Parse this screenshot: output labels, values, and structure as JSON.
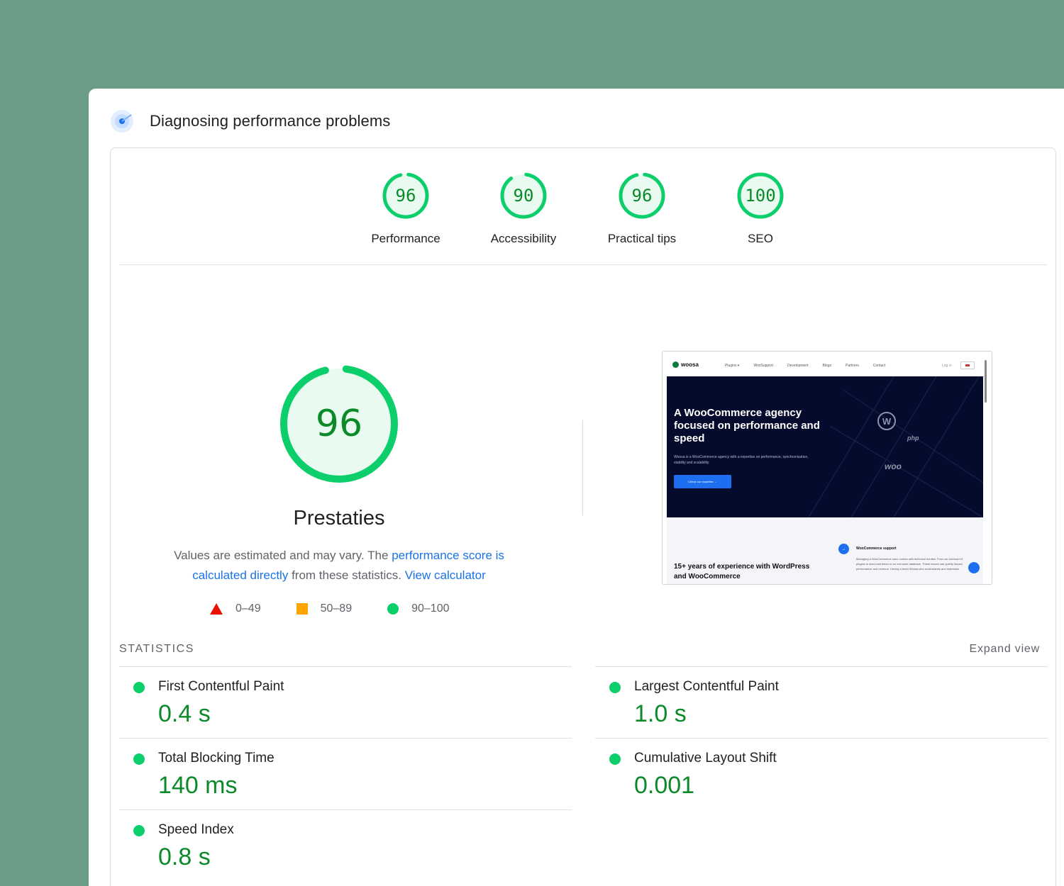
{
  "window": {
    "title": "Diagnosing performance problems"
  },
  "gauges": [
    {
      "score": "96",
      "value": 96,
      "label": "Performance"
    },
    {
      "score": "90",
      "value": 90,
      "label": "Accessibility"
    },
    {
      "score": "96",
      "value": 96,
      "label": "Practical tips"
    },
    {
      "score": "100",
      "value": 100,
      "label": "SEO"
    }
  ],
  "main_score": {
    "score": "96",
    "value": 96,
    "label": "Prestaties"
  },
  "description": {
    "text1": "Values are estimated and may vary. The ",
    "link1": "performance score is calculated directly",
    "text2": " from these statistics. ",
    "link2": "View calculator"
  },
  "legend": {
    "poor": "0–49",
    "average": "50–89",
    "good": "90–100"
  },
  "preview": {
    "logo": "woosa",
    "menu": [
      "Plugins ▾",
      "WooSupport",
      "Development",
      "Blogs",
      "Partners",
      "Contact"
    ],
    "login": "Log in",
    "hero_title": "A WooCommerce agency focused on performance and speed",
    "hero_sub": "Woosa is a WooCommerce agency with a expertise on performance, synchronisation, stability and scalability",
    "hero_button": "Check our expertise →",
    "tag_wp": "W",
    "tag_php": "php",
    "tag_woo": "woo",
    "lower_title": "15+ years of experience with WordPress and WooCommerce",
    "lower_heading": "WooCommerce support",
    "lower_text": "Managing a WooCommerce store comes with technical hurdles. From an overload of plugins to slow load times or an overused database. These issues can quietly impact performance and revenue. Having a team Woosa who understands and maintains"
  },
  "statistics": {
    "title": "STATISTICS",
    "expand": "Expand view",
    "metrics": [
      {
        "name": "First Contentful Paint",
        "value": "0.4 s"
      },
      {
        "name": "Largest Contentful Paint",
        "value": "1.0 s"
      },
      {
        "name": "Total Blocking Time",
        "value": "140 ms"
      },
      {
        "name": "Cumulative Layout Shift",
        "value": "0.001"
      },
      {
        "name": "Speed Index",
        "value": "0.8 s"
      }
    ]
  },
  "colors": {
    "good": "#0cce6b",
    "good_text": "#0b8a2a",
    "average": "#ffa400",
    "poor": "#eb0f00",
    "link": "#1a73e8",
    "background": "#6b9c87"
  }
}
